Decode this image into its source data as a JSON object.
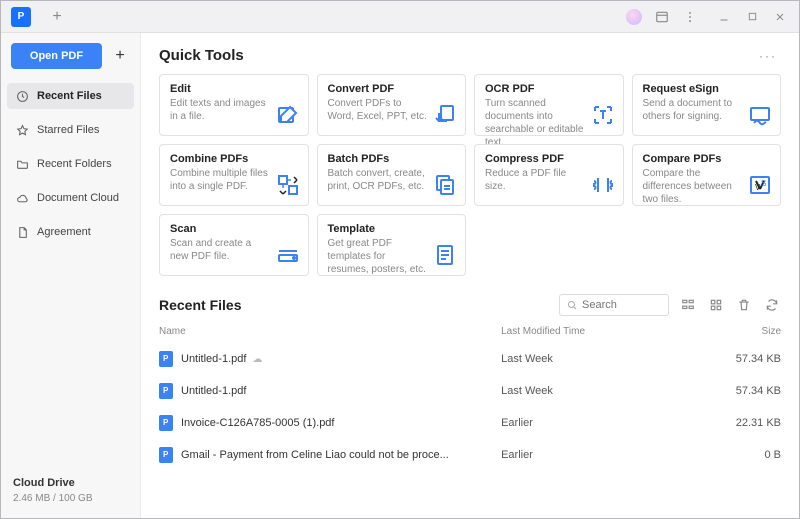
{
  "titlebar": {
    "plus": "+"
  },
  "sidebar": {
    "open_label": "Open PDF",
    "add": "+",
    "items": [
      {
        "label": "Recent Files",
        "icon": "clock",
        "active": true
      },
      {
        "label": "Starred Files",
        "icon": "star",
        "active": false
      },
      {
        "label": "Recent Folders",
        "icon": "folder",
        "active": false
      },
      {
        "label": "Document Cloud",
        "icon": "cloud",
        "active": false
      },
      {
        "label": "Agreement",
        "icon": "doc",
        "active": false
      }
    ],
    "drive_label": "Cloud Drive",
    "drive_quota": "2.46 MB / 100 GB"
  },
  "quick_tools": {
    "title": "Quick Tools",
    "more": "···",
    "tools": [
      {
        "title": "Edit",
        "desc": "Edit texts and images in a file.",
        "icon": "edit"
      },
      {
        "title": "Convert PDF",
        "desc": "Convert PDFs to Word, Excel, PPT, etc.",
        "icon": "convert"
      },
      {
        "title": "OCR PDF",
        "desc": "Turn scanned documents into searchable or editable text.",
        "icon": "ocr"
      },
      {
        "title": "Request eSign",
        "desc": "Send a document to others for signing.",
        "icon": "esign"
      },
      {
        "title": "Combine PDFs",
        "desc": "Combine multiple files into a single PDF.",
        "icon": "combine"
      },
      {
        "title": "Batch PDFs",
        "desc": "Batch convert, create, print, OCR PDFs, etc.",
        "icon": "batch"
      },
      {
        "title": "Compress PDF",
        "desc": "Reduce a PDF file size.",
        "icon": "compress"
      },
      {
        "title": "Compare PDFs",
        "desc": "Compare the differences between two files.",
        "icon": "compare"
      },
      {
        "title": "Scan",
        "desc": "Scan and create a new PDF file.",
        "icon": "scan"
      },
      {
        "title": "Template",
        "desc": "Get great PDF templates for resumes, posters, etc.",
        "icon": "template"
      }
    ]
  },
  "recent": {
    "title": "Recent Files",
    "search_placeholder": "Search",
    "cols": {
      "name": "Name",
      "mod": "Last Modified Time",
      "size": "Size"
    },
    "files": [
      {
        "name": "Untitled-1.pdf",
        "mod": "Last Week",
        "size": "57.34 KB",
        "cloud": true
      },
      {
        "name": "Untitled-1.pdf",
        "mod": "Last Week",
        "size": "57.34 KB",
        "cloud": false
      },
      {
        "name": "Invoice-C126A785-0005 (1).pdf",
        "mod": "Earlier",
        "size": "22.31 KB",
        "cloud": false
      },
      {
        "name": "Gmail - Payment from Celine Liao could not be proce...",
        "mod": "Earlier",
        "size": "0 B",
        "cloud": false
      }
    ]
  }
}
